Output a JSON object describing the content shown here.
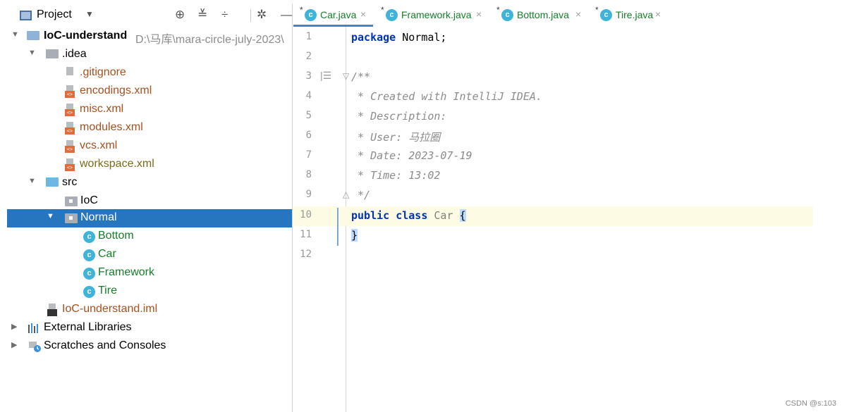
{
  "project_panel": {
    "title": "Project",
    "caret": "▼",
    "tools": [
      "⊕",
      "≚",
      "÷",
      "✲",
      "—"
    ],
    "tool_names": [
      "locate-icon",
      "expand-all-icon",
      "collapse-all-icon",
      "settings-gear-icon",
      "hide-panel-icon"
    ],
    "tree": {
      "root": {
        "label": "IoC-understand",
        "path": "D:\\马库\\mara-circle-july-2023\\"
      },
      "idea": {
        "label": ".idea"
      },
      "idea_files": [
        {
          "label": ".gitignore",
          "color": "brown"
        },
        {
          "label": "encodings.xml",
          "color": "brown"
        },
        {
          "label": "misc.xml",
          "color": "brown"
        },
        {
          "label": "modules.xml",
          "color": "brown"
        },
        {
          "label": "vcs.xml",
          "color": "brown"
        },
        {
          "label": "workspace.xml",
          "color": "olive"
        }
      ],
      "src": {
        "label": "src"
      },
      "ioc": {
        "label": "IoC"
      },
      "normal": {
        "label": "Normal"
      },
      "classes": [
        "Bottom",
        "Car",
        "Framework",
        "Tire"
      ],
      "iml": {
        "label": "IoC-understand.iml"
      },
      "external_libraries": {
        "label": "External Libraries"
      },
      "scratches": {
        "label": "Scratches and Consoles"
      }
    }
  },
  "editor": {
    "tabs": [
      {
        "label": "Car.java",
        "active": true
      },
      {
        "label": "Framework.java",
        "active": false
      },
      {
        "label": "Bottom.java",
        "active": false
      },
      {
        "label": "Tire.java",
        "active": false
      }
    ],
    "tab_star": "*",
    "tab_icon_letter": "c",
    "close_glyph": "×",
    "line_numbers": [
      "1",
      "2",
      "3",
      "4",
      "5",
      "6",
      "7",
      "8",
      "9",
      "10",
      "11",
      "12"
    ],
    "current_line": "10",
    "code": {
      "l1_kw": "package",
      "l1_rest": " Normal;",
      "l3": "/**",
      "l4": " * Created with IntelliJ IDEA.",
      "l5": " * Description:",
      "l6": " * User: 马拉圈",
      "l7": " * Date: 2023-07-19",
      "l8": " * Time: 13:02",
      "l9": " */",
      "l10_kw1": "public",
      "l10_kw2": "class",
      "l10_name": "Car",
      "l10_brace": "{",
      "l11_brace": "}"
    }
  },
  "watermark": "CSDN @s:103",
  "colors": {
    "selection": "#2675bf",
    "keyword": "#0033b3",
    "class_label": "#167d2a",
    "xml_label": "#a7501f",
    "current_line_bg": "#fdfbe4",
    "tab_underline": "#4083c9"
  }
}
